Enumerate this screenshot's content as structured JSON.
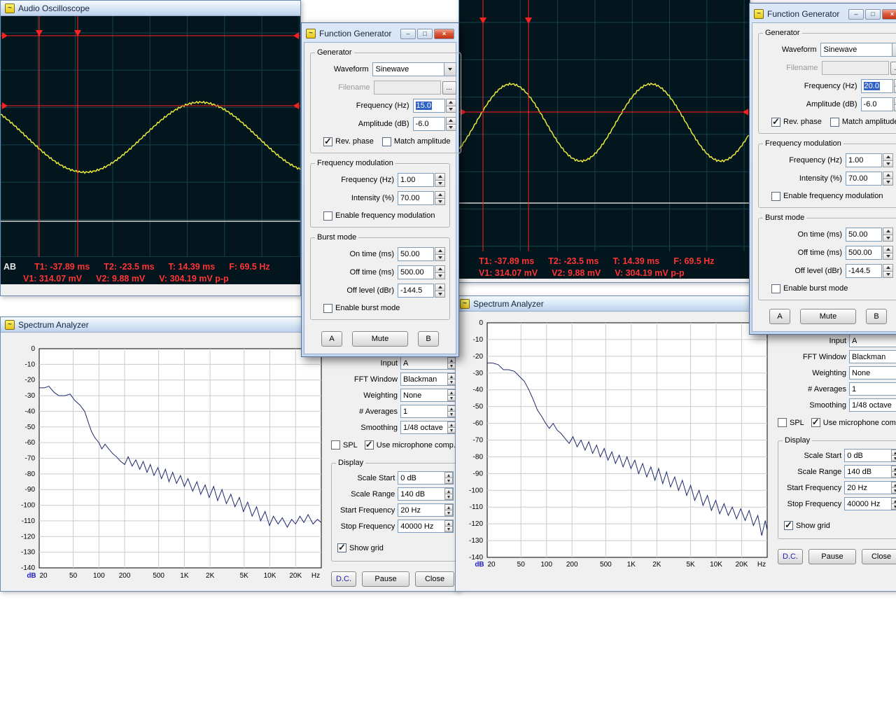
{
  "osc_left": {
    "title": "Audio Oscilloscope",
    "channels": "AB",
    "time_readings": [
      "T1: -37.89 ms",
      "T2: -23.5 ms",
      "T: 14.39 ms",
      "F: 69.5 Hz"
    ],
    "volt_readings": [
      "V1: 314.07 mV",
      "V2: 9.88 mV",
      "V: 304.19 mV p-p"
    ],
    "scope": {
      "cursors_v": [
        55,
        110
      ],
      "cursors_h": [
        28,
        128
      ],
      "tri_y": 20,
      "trace_b_y": 293,
      "wave": {
        "center": 173,
        "amp": 50,
        "period": 330,
        "trough_x": 120
      }
    }
  },
  "osc_right": {
    "time_readings": [
      "T1: -37.89 ms",
      "T2: -23.5 ms",
      "T: 14.39 ms",
      "F: 69.5 Hz"
    ],
    "volt_readings": [
      "V1: 314.07 mV",
      "V2: 9.88 mV",
      "V: 304.19 mV p-p"
    ],
    "scope": {
      "cursors_v": [
        34,
        99
      ],
      "cursors_h": [
        161
      ],
      "tri_y": 26,
      "trace_b_y": 291,
      "wave": {
        "center": 176,
        "amp": 55,
        "period": 200,
        "trough_x": 174
      }
    }
  },
  "fg_left": {
    "title": "Function Generator",
    "grp_generator": "Generator",
    "grp_fm": "Frequency modulation",
    "grp_burst": "Burst mode",
    "waveform_label": "Waveform",
    "waveform_value": "Sinewave",
    "filename_label": "Filename",
    "browse": "...",
    "freq_label": "Frequency (Hz)",
    "freq_value": "15.0",
    "amp_label": "Amplitude (dB)",
    "amp_value": "-6.0",
    "rev_phase_label": "Rev. phase",
    "match_amp_label": "Match amplitude",
    "fm_freq_label": "Frequency (Hz)",
    "fm_freq_value": "1.00",
    "fm_int_label": "Intensity (%)",
    "fm_int_value": "70.00",
    "fm_enable_label": "Enable frequency modulation",
    "burst_on_label": "On time (ms)",
    "burst_on_value": "50.00",
    "burst_off_label": "Off time (ms)",
    "burst_off_value": "500.00",
    "burst_lvl_label": "Off level (dBr)",
    "burst_lvl_value": "-144.5",
    "burst_enable_label": "Enable burst mode",
    "btn_a": "A",
    "btn_mute": "Mute",
    "btn_b": "B"
  },
  "fg_right": {
    "title": "Function Generator",
    "grp_generator": "Generator",
    "grp_fm": "Frequency modulation",
    "grp_burst": "Burst mode",
    "waveform_label": "Waveform",
    "waveform_value": "Sinewave",
    "filename_label": "Filename",
    "browse": "...",
    "freq_label": "Frequency (Hz)",
    "freq_value": "20.0",
    "amp_label": "Amplitude (dB)",
    "amp_value": "-6.0",
    "rev_phase_label": "Rev. phase",
    "match_amp_label": "Match amplitude",
    "fm_freq_label": "Frequency (Hz)",
    "fm_freq_value": "1.00",
    "fm_int_label": "Intensity (%)",
    "fm_int_value": "70.00",
    "fm_enable_label": "Enable frequency modulation",
    "burst_on_label": "On time (ms)",
    "burst_on_value": "50.00",
    "burst_off_label": "Off time (ms)",
    "burst_off_value": "500.00",
    "burst_lvl_label": "Off level (dBr)",
    "burst_lvl_value": "-144.5",
    "burst_enable_label": "Enable burst mode",
    "btn_a": "A",
    "btn_mute": "Mute",
    "btn_b": "B"
  },
  "sa_left": {
    "title": "Spectrum Analyzer",
    "input_label": "Input",
    "input_value": "A",
    "fft_label": "FFT Window",
    "fft_value": "Blackman",
    "weight_label": "Weighting",
    "weight_value": "None",
    "avg_label": "# Averages",
    "avg_value": "1",
    "smooth_label": "Smoothing",
    "smooth_value": "1/48 octave",
    "spl_label": "SPL",
    "mic_label": "Use microphone comp.",
    "display_group": "Display",
    "scale_start_label": "Scale Start",
    "scale_start_value": "0 dB",
    "scale_range_label": "Scale Range",
    "scale_range_value": "140 dB",
    "start_freq_label": "Start Frequency",
    "start_freq_value": "20 Hz",
    "stop_freq_label": "Stop Frequency",
    "stop_freq_value": "40000 Hz",
    "show_grid_label": "Show grid",
    "btn_dc": "D.C.",
    "btn_pause": "Pause",
    "btn_close": "Close",
    "plot": {
      "db_label": "dB",
      "hz_label": "Hz",
      "fmin": 20,
      "fmax": 40000,
      "db_min": -140,
      "db_max": 0,
      "y_ticks": [
        "0",
        "-10",
        "-20",
        "-30",
        "-40",
        "-50",
        "-60",
        "-70",
        "-80",
        "-90",
        "-100",
        "-110",
        "-120",
        "-130",
        "-140"
      ],
      "x_ticks": [
        [
          20,
          "20"
        ],
        [
          50,
          "50"
        ],
        [
          100,
          "100"
        ],
        [
          200,
          "200"
        ],
        [
          500,
          "500"
        ],
        [
          1000,
          "1K"
        ],
        [
          2000,
          "2K"
        ],
        [
          5000,
          "5K"
        ],
        [
          10000,
          "10K"
        ],
        [
          20000,
          "20K"
        ]
      ],
      "grid_freqs": [
        50,
        100,
        200,
        500,
        1000,
        2000,
        5000,
        10000,
        20000
      ],
      "points": [
        [
          20,
          -25
        ],
        [
          23,
          -25
        ],
        [
          26,
          -24
        ],
        [
          30,
          -28
        ],
        [
          34,
          -30
        ],
        [
          40,
          -30
        ],
        [
          46,
          -29
        ],
        [
          52,
          -33
        ],
        [
          60,
          -36
        ],
        [
          68,
          -40
        ],
        [
          75,
          -47
        ],
        [
          82,
          -53
        ],
        [
          90,
          -57
        ],
        [
          100,
          -60
        ],
        [
          108,
          -64
        ],
        [
          118,
          -61
        ],
        [
          130,
          -64
        ],
        [
          145,
          -67
        ],
        [
          160,
          -69
        ],
        [
          180,
          -72
        ],
        [
          200,
          -74
        ],
        [
          220,
          -69
        ],
        [
          245,
          -75
        ],
        [
          270,
          -71
        ],
        [
          300,
          -77
        ],
        [
          330,
          -72
        ],
        [
          365,
          -79
        ],
        [
          400,
          -74
        ],
        [
          440,
          -81
        ],
        [
          490,
          -76
        ],
        [
          540,
          -83
        ],
        [
          600,
          -77
        ],
        [
          660,
          -85
        ],
        [
          730,
          -79
        ],
        [
          810,
          -86
        ],
        [
          900,
          -81
        ],
        [
          1000,
          -88
        ],
        [
          1100,
          -83
        ],
        [
          1250,
          -91
        ],
        [
          1400,
          -85
        ],
        [
          1550,
          -93
        ],
        [
          1750,
          -87
        ],
        [
          1950,
          -95
        ],
        [
          2200,
          -88
        ],
        [
          2450,
          -97
        ],
        [
          2750,
          -90
        ],
        [
          3100,
          -99
        ],
        [
          3500,
          -93
        ],
        [
          3900,
          -101
        ],
        [
          4400,
          -95
        ],
        [
          4900,
          -104
        ],
        [
          5500,
          -98
        ],
        [
          6200,
          -107
        ],
        [
          7000,
          -101
        ],
        [
          7800,
          -110
        ],
        [
          8800,
          -104
        ],
        [
          9900,
          -113
        ],
        [
          11000,
          -107
        ],
        [
          12500,
          -112
        ],
        [
          14000,
          -108
        ],
        [
          16000,
          -114
        ],
        [
          18000,
          -109
        ],
        [
          20000,
          -112
        ],
        [
          22500,
          -107
        ],
        [
          25000,
          -111
        ],
        [
          28000,
          -106
        ],
        [
          32000,
          -112
        ],
        [
          36000,
          -109
        ],
        [
          40000,
          -111
        ]
      ]
    }
  },
  "sa_right": {
    "title": "Spectrum Analyzer",
    "input_label": "Input",
    "input_value": "A",
    "fft_label": "FFT Window",
    "fft_value": "Blackman",
    "weight_label": "Weighting",
    "weight_value": "None",
    "avg_label": "# Averages",
    "avg_value": "1",
    "smooth_label": "Smoothing",
    "smooth_value": "1/48 octave",
    "spl_label": "SPL",
    "mic_label": "Use microphone comp.",
    "display_group": "Display",
    "scale_start_label": "Scale Start",
    "scale_start_value": "0 dB",
    "scale_range_label": "Scale Range",
    "scale_range_value": "140 dB",
    "start_freq_label": "Start Frequency",
    "start_freq_value": "20 Hz",
    "stop_freq_label": "Stop Frequency",
    "stop_freq_value": "40000 Hz",
    "show_grid_label": "Show grid",
    "btn_dc": "D.C.",
    "btn_pause": "Pause",
    "btn_close": "Close",
    "plot": {
      "db_label": "dB",
      "hz_label": "Hz",
      "fmin": 20,
      "fmax": 40000,
      "db_min": -140,
      "db_max": 0,
      "y_ticks": [
        "0",
        "-10",
        "-20",
        "-30",
        "-40",
        "-50",
        "-60",
        "-70",
        "-80",
        "-90",
        "-100",
        "-110",
        "-120",
        "-130",
        "-140"
      ],
      "x_ticks": [
        [
          20,
          "20"
        ],
        [
          50,
          "50"
        ],
        [
          100,
          "100"
        ],
        [
          200,
          "200"
        ],
        [
          500,
          "500"
        ],
        [
          1000,
          "1K"
        ],
        [
          2000,
          "2K"
        ],
        [
          5000,
          "5K"
        ],
        [
          10000,
          "10K"
        ],
        [
          20000,
          "20K"
        ]
      ],
      "grid_freqs": [
        50,
        100,
        200,
        500,
        1000,
        2000,
        5000,
        10000,
        20000
      ],
      "points": [
        [
          20,
          -24
        ],
        [
          23,
          -24
        ],
        [
          27,
          -25
        ],
        [
          31,
          -28
        ],
        [
          36,
          -28
        ],
        [
          42,
          -29
        ],
        [
          48,
          -32
        ],
        [
          55,
          -35
        ],
        [
          62,
          -40
        ],
        [
          70,
          -46
        ],
        [
          78,
          -52
        ],
        [
          88,
          -56
        ],
        [
          98,
          -60
        ],
        [
          108,
          -63
        ],
        [
          120,
          -60
        ],
        [
          133,
          -64
        ],
        [
          148,
          -66
        ],
        [
          165,
          -69
        ],
        [
          185,
          -72
        ],
        [
          205,
          -68
        ],
        [
          230,
          -74
        ],
        [
          255,
          -70
        ],
        [
          285,
          -76
        ],
        [
          315,
          -71
        ],
        [
          350,
          -78
        ],
        [
          390,
          -73
        ],
        [
          430,
          -80
        ],
        [
          480,
          -75
        ],
        [
          530,
          -82
        ],
        [
          590,
          -77
        ],
        [
          650,
          -84
        ],
        [
          720,
          -79
        ],
        [
          800,
          -86
        ],
        [
          890,
          -80
        ],
        [
          990,
          -87
        ],
        [
          1100,
          -82
        ],
        [
          1220,
          -90
        ],
        [
          1360,
          -84
        ],
        [
          1520,
          -92
        ],
        [
          1700,
          -86
        ],
        [
          1900,
          -94
        ],
        [
          2100,
          -87
        ],
        [
          2350,
          -96
        ],
        [
          2600,
          -89
        ],
        [
          2900,
          -98
        ],
        [
          3250,
          -92
        ],
        [
          3600,
          -100
        ],
        [
          4000,
          -94
        ],
        [
          4500,
          -103
        ],
        [
          5000,
          -97
        ],
        [
          5600,
          -106
        ],
        [
          6300,
          -100
        ],
        [
          7000,
          -109
        ],
        [
          7900,
          -103
        ],
        [
          8800,
          -112
        ],
        [
          9900,
          -106
        ],
        [
          11000,
          -114
        ],
        [
          12400,
          -108
        ],
        [
          13900,
          -115
        ],
        [
          15500,
          -110
        ],
        [
          17400,
          -117
        ],
        [
          19500,
          -111
        ],
        [
          22000,
          -118
        ],
        [
          24500,
          -112
        ],
        [
          27500,
          -121
        ],
        [
          31000,
          -115
        ],
        [
          34500,
          -127
        ],
        [
          38000,
          -118
        ],
        [
          40000,
          -124
        ]
      ]
    }
  }
}
